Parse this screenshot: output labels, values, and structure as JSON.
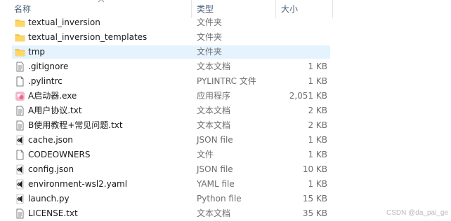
{
  "header": {
    "name": "名称",
    "type": "类型",
    "size": "大小"
  },
  "rows": [
    {
      "name": "textual_inversion",
      "type": "文件夹",
      "size": "",
      "icon": "folder-icon"
    },
    {
      "name": "textual_inversion_templates",
      "type": "文件夹",
      "size": "",
      "icon": "folder-icon"
    },
    {
      "name": "tmp",
      "type": "文件夹",
      "size": "",
      "icon": "folder-icon",
      "hovered": true
    },
    {
      "name": ".gitignore",
      "type": "文本文档",
      "size": "1 KB",
      "icon": "text-file-icon"
    },
    {
      "name": ".pylintrc",
      "type": "PYLINTRC 文件",
      "size": "1 KB",
      "icon": "generic-file-icon"
    },
    {
      "name": "A启动器.exe",
      "type": "应用程序",
      "size": "2,051 KB",
      "icon": "app-exe-icon"
    },
    {
      "name": "A用户协议.txt",
      "type": "文本文档",
      "size": "2 KB",
      "icon": "text-file-icon"
    },
    {
      "name": "B使用教程+常见问题.txt",
      "type": "文本文档",
      "size": "2 KB",
      "icon": "text-file-icon"
    },
    {
      "name": "cache.json",
      "type": "JSON file",
      "size": "1 KB",
      "icon": "vscode-file-icon"
    },
    {
      "name": "CODEOWNERS",
      "type": "文件",
      "size": "1 KB",
      "icon": "generic-file-icon"
    },
    {
      "name": "config.json",
      "type": "JSON file",
      "size": "10 KB",
      "icon": "vscode-file-icon"
    },
    {
      "name": "environment-wsl2.yaml",
      "type": "YAML file",
      "size": "1 KB",
      "icon": "vscode-file-icon"
    },
    {
      "name": "launch.py",
      "type": "Python file",
      "size": "15 KB",
      "icon": "vscode-file-icon"
    },
    {
      "name": "LICENSE.txt",
      "type": "文本文档",
      "size": "35 KB",
      "icon": "text-file-icon"
    }
  ],
  "watermark": "CSDN @da_pai_ge",
  "colors": {
    "hover_bg": "#e5f3ff",
    "folder": "#f2c94c",
    "header_text": "#4c607a"
  }
}
